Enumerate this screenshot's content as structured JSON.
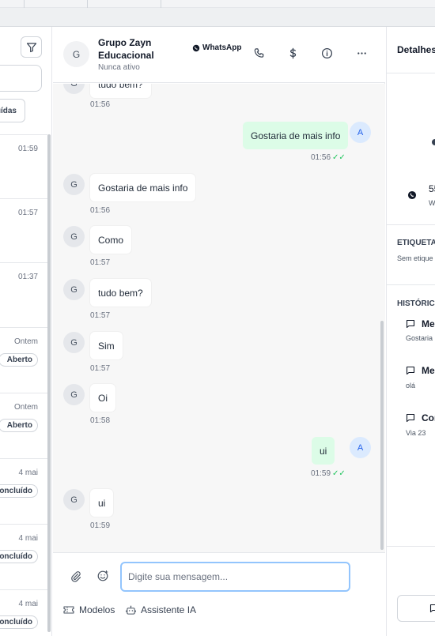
{
  "left": {
    "filter_button": "filter-icon",
    "status_pill": "uídas",
    "conversations": [
      {
        "time": "01:59",
        "badge": ""
      },
      {
        "time": "01:57",
        "badge": ""
      },
      {
        "time": "01:37",
        "badge": ""
      },
      {
        "time": "Ontem",
        "badge": "Aberto"
      },
      {
        "time": "Ontem",
        "badge": "Aberto"
      },
      {
        "time": "4 mai",
        "badge": "oncluído"
      },
      {
        "time": "4 mai",
        "badge": "oncluído"
      },
      {
        "time": "4 mai",
        "badge": "oncluído"
      }
    ]
  },
  "header": {
    "avatar": "G",
    "name": "Grupo Zayn Educacional",
    "status": "Nunca ativo",
    "channel": "WhatsApp",
    "icons": [
      "phone-icon",
      "dollar-icon",
      "info-icon",
      "more-icon"
    ]
  },
  "messages": [
    {
      "dir": "in",
      "avatar": "G",
      "text": "tudo bem?",
      "time": "01:56"
    },
    {
      "dir": "out",
      "avatar": "A",
      "text": "Gostaria de mais info",
      "time": "01:56"
    },
    {
      "dir": "in",
      "avatar": "G",
      "text": "Gostaria de mais info",
      "time": "01:56"
    },
    {
      "dir": "in",
      "avatar": "G",
      "text": "Como",
      "time": "01:57"
    },
    {
      "dir": "in",
      "avatar": "G",
      "text": "tudo bem?",
      "time": "01:57"
    },
    {
      "dir": "in",
      "avatar": "G",
      "text": "Sim",
      "time": "01:57"
    },
    {
      "dir": "in",
      "avatar": "G",
      "text": "Oi",
      "time": "01:58"
    },
    {
      "dir": "out",
      "avatar": "A",
      "text": "ui",
      "time": "01:59"
    },
    {
      "dir": "in",
      "avatar": "G",
      "text": "ui",
      "time": "01:59"
    }
  ],
  "composer": {
    "placeholder": "Digite sua mensagem...",
    "templates_label": "Modelos",
    "assistant_label": "Assistente IA"
  },
  "details": {
    "title": "Detalhes",
    "phone_fragment": "55",
    "phone_sub": "W",
    "tags_label": "ETIQUETAS",
    "tags_empty": "Sem etique",
    "history_label": "HISTÓRICO",
    "history": [
      {
        "title": "Me",
        "sub": "Gostaria"
      },
      {
        "title": "Me",
        "sub": "olá"
      },
      {
        "title": "Con",
        "sub": "Via 23"
      }
    ]
  },
  "colors": {
    "outgoing_bubble": "#dcfce7",
    "read_ticks": "#22c55e",
    "input_focus": "#93c5fd"
  }
}
